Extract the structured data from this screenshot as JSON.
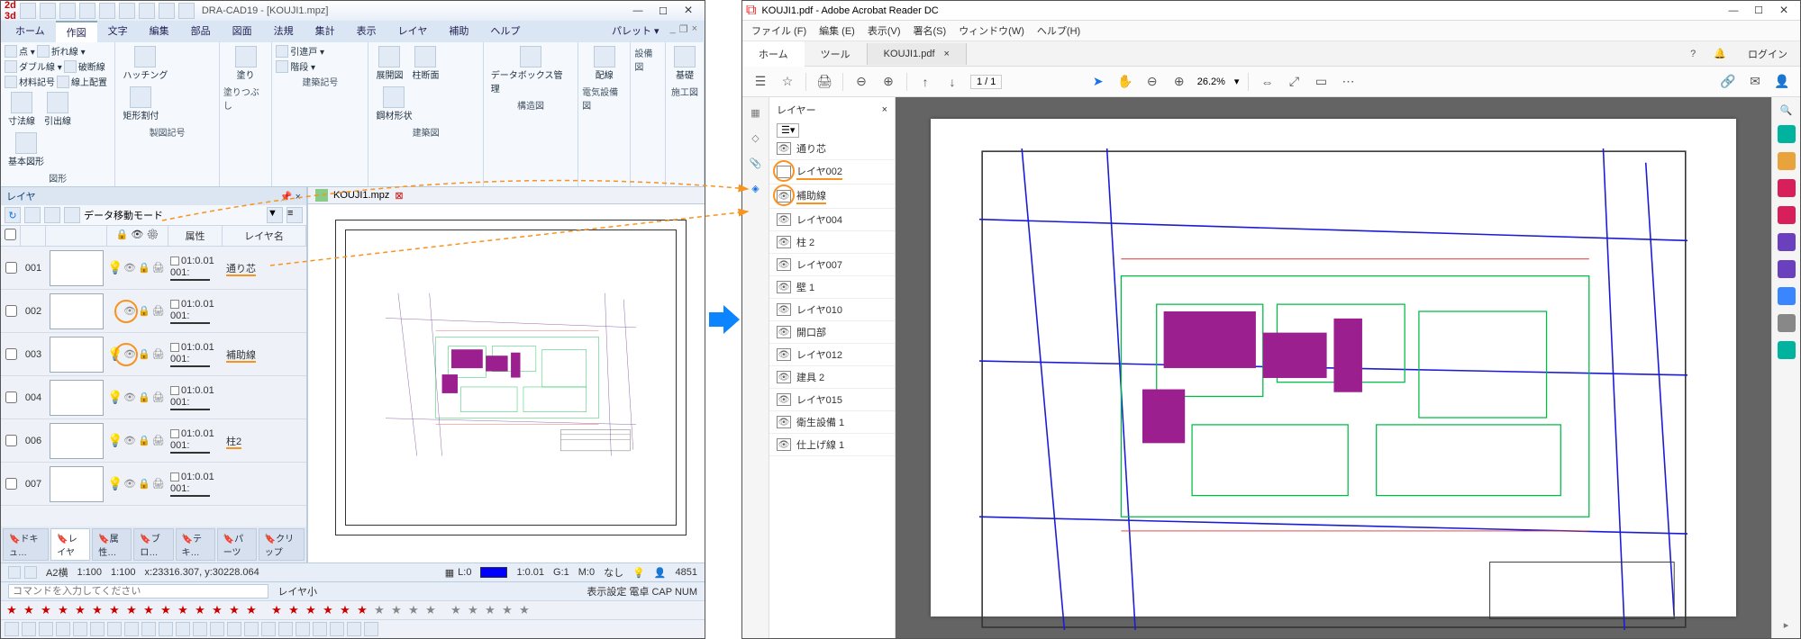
{
  "dracad": {
    "title": "DRA-CAD19 - [KOUJI1.mpz]",
    "ribbon_tabs": [
      "ホーム",
      "作図",
      "文字",
      "編集",
      "部品",
      "図面",
      "法規",
      "集計",
      "表示",
      "レイヤ",
      "補助",
      "ヘルプ"
    ],
    "active_tab": "作図",
    "palette_label": "パレット ▾",
    "groups": [
      {
        "label": "図形",
        "small": [
          "点 ▾",
          "折れ線 ▾",
          "ダブル線 ▾",
          "破断線",
          "材料記号",
          "線上配置"
        ],
        "big": [
          "寸法線",
          "引出線",
          "基本図形"
        ]
      },
      {
        "label": "製図記号",
        "big": [
          "ハッチング",
          "矩形割付"
        ]
      },
      {
        "label": "塗りつぶし",
        "big": [
          "塗り"
        ]
      },
      {
        "label": "建築記号",
        "small": [
          "引違戸 ▾",
          "階段 ▾"
        ]
      },
      {
        "label": "建築図",
        "big": [
          "展開図",
          "柱断面",
          "鋼材形状"
        ]
      },
      {
        "label": "構造図",
        "big": [
          "データボックス管理"
        ]
      },
      {
        "label": "電気設備図",
        "big": [
          "配線"
        ]
      },
      {
        "label": "設備図",
        "big": []
      },
      {
        "label": "施工図",
        "big": [
          "基礎"
        ]
      }
    ],
    "layer_panel": {
      "title": "レイヤ",
      "mode": "データ移動モード",
      "columns": {
        "attr": "属性",
        "name": "レイヤ名"
      },
      "rows": [
        {
          "num": "001",
          "attr_top": "01:0.01",
          "attr_bot": "001:",
          "name": "通り芯",
          "bulb": "yellow"
        },
        {
          "num": "002",
          "attr_top": "01:0.01",
          "attr_bot": "001:",
          "name": "",
          "bulb": "off",
          "ring": true
        },
        {
          "num": "003",
          "attr_top": "01:0.01",
          "attr_bot": "001:",
          "name": "補助線",
          "bulb": "yellow",
          "ring": true
        },
        {
          "num": "004",
          "attr_top": "01:0.01",
          "attr_bot": "001:",
          "name": "",
          "bulb": "yellow"
        },
        {
          "num": "006",
          "attr_top": "01:0.01",
          "attr_bot": "001:",
          "name": "柱2",
          "bulb": "yellow"
        },
        {
          "num": "007",
          "attr_top": "01:0.01",
          "attr_bot": "001:",
          "name": "",
          "bulb": "yellow"
        }
      ]
    },
    "bottom_tabs": [
      "ドキュ…",
      "レイヤ",
      "属性…",
      "ブロ…",
      "テキ…",
      "パーツ",
      "クリップ"
    ],
    "doc_tab": "KOUJI1.mpz",
    "cmd_prompt": "コマンドを入力してください",
    "status": {
      "paper": "A2横",
      "s1": "1:100",
      "s2": "1:100",
      "coords": "x:23316.307, y:30228.064",
      "layer_l": "L:0",
      "col": "1:0.01",
      "grp": "G:1",
      "mat": "M:0",
      "none": "なし",
      "count": "4851",
      "layer_small": "レイヤ小",
      "right": "表示設定 電卓 CAP NUM"
    }
  },
  "acrobat": {
    "title": "KOUJI1.pdf - Adobe Acrobat Reader DC",
    "menus": [
      "ファイル (F)",
      "編集 (E)",
      "表示(V)",
      "署名(S)",
      "ウィンドウ(W)",
      "ヘルプ(H)"
    ],
    "tabs": {
      "home": "ホーム",
      "tool": "ツール",
      "doc": "KOUJI1.pdf"
    },
    "login": "ログイン",
    "page": "1 / 1",
    "zoom": "26.2%",
    "layer_title": "レイヤー",
    "layers": [
      {
        "name": "通り芯",
        "eye": true
      },
      {
        "name": "レイヤ002",
        "eye": false,
        "ring": true,
        "hl": true
      },
      {
        "name": "補助線",
        "eye": true,
        "ring": true,
        "hl": true
      },
      {
        "name": "レイヤ004",
        "eye": true
      },
      {
        "name": "柱 2",
        "eye": true
      },
      {
        "name": "レイヤ007",
        "eye": true
      },
      {
        "name": "壁 1",
        "eye": true
      },
      {
        "name": "レイヤ010",
        "eye": true
      },
      {
        "name": "開口部",
        "eye": true
      },
      {
        "name": "レイヤ012",
        "eye": true
      },
      {
        "name": "建具 2",
        "eye": true
      },
      {
        "name": "レイヤ015",
        "eye": true
      },
      {
        "name": "衛生設備 1",
        "eye": true
      },
      {
        "name": "仕上げ線 1",
        "eye": true
      }
    ],
    "rtool_colors": [
      "#00b39f",
      "#e8a33d",
      "#d81e5b",
      "#d81e5b",
      "#6a40bf",
      "#6a40bf",
      "#3a86ff",
      "#888",
      "#00b39f"
    ]
  }
}
